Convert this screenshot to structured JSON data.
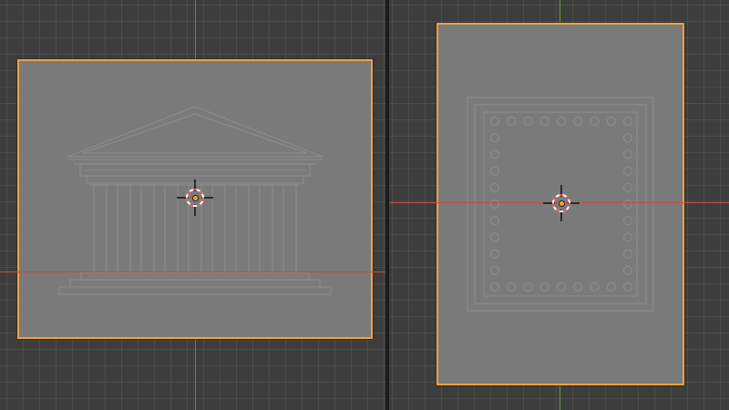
{
  "app": "3D viewport",
  "viewports": [
    {
      "id": "left",
      "view": "front",
      "object": {
        "reference_image": "temple-facade",
        "selected": true
      },
      "axes": {
        "horizontal": "X",
        "vertical": "Z"
      }
    },
    {
      "id": "right",
      "view": "top",
      "object": {
        "reference_image": "temple-floor-plan",
        "selected": true
      },
      "axes": {
        "horizontal": "X",
        "vertical": "Y"
      }
    }
  ],
  "colors": {
    "background": "#3d3d3d",
    "grid_line": "#474747",
    "divider": "#1c1c1c",
    "selection_outline": "#f0a23c",
    "plane_fill": "#7a7a7a",
    "reference_lines": "#8c8c8c",
    "x_axis": "#c84a4a",
    "y_axis": "#6e9a3a",
    "z_axis": "#4a78c2",
    "cursor_ring_red": "#e85050",
    "cursor_ring_white": "#ffffff",
    "origin_dot": "#f0a23c"
  }
}
